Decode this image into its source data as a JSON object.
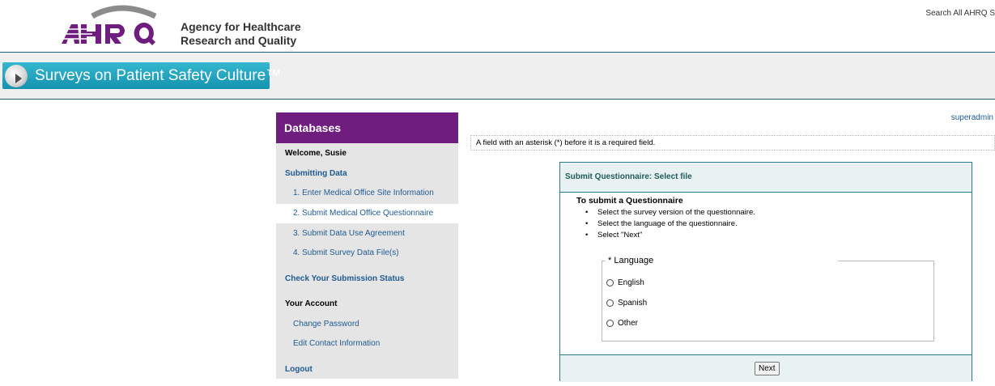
{
  "header": {
    "agency_line1": "Agency for Healthcare",
    "agency_line2": "Research and Quality",
    "search_text": "Search All AHRQ S",
    "logo_text": "AHRQ"
  },
  "banner": {
    "title": "Surveys on Patient Safety Culture™"
  },
  "sidebar": {
    "title": "Databases",
    "welcome": "Welcome, Susie",
    "section_submitting": "Submitting Data",
    "items": [
      "1. Enter Medical Office Site Information",
      "2. Submit Medical Office Questionnaire",
      "3. Submit Data Use Agreement",
      "4. Submit Survey Data File(s)"
    ],
    "check_status": "Check Your Submission Status",
    "your_account": "Your Account",
    "change_password": "Change Password",
    "edit_contact": "Edit Contact Information",
    "logout": "Logout"
  },
  "main": {
    "user": "superadmin",
    "notice": "A field with an asterisk (*) before it is a required field.",
    "panel_title": "Submit Questionnaire: Select file",
    "instr_title": "To submit a Questionnaire",
    "instructions": [
      "Select the survey version of the questionnaire.",
      "Select the language of the questionnaire.",
      "Select \"Next\""
    ],
    "language_legend": "* Language",
    "languages": [
      "English",
      "Spanish",
      "Other"
    ],
    "next_label": "Next"
  },
  "colors": {
    "sidebar_header": "#6f1e80",
    "link": "#1f5a90",
    "panel_border": "#2b7a86",
    "banner_teal": "#1493b0"
  }
}
